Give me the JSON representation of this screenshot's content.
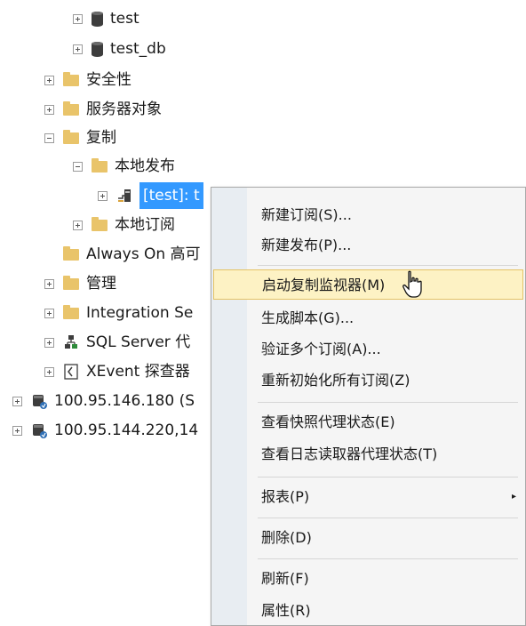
{
  "tree": {
    "nodes": [
      {
        "label": "test",
        "icon": "database-icon"
      },
      {
        "label": "test_db",
        "icon": "database-icon"
      },
      {
        "label": "安全性",
        "icon": "folder-icon"
      },
      {
        "label": "服务器对象",
        "icon": "folder-icon"
      },
      {
        "label": "复制",
        "icon": "folder-icon"
      },
      {
        "label": "本地发布",
        "icon": "folder-icon"
      },
      {
        "label": "[test]: t",
        "icon": "publication-icon"
      },
      {
        "label": "本地订阅",
        "icon": "folder-icon"
      },
      {
        "label": "Always On 高可",
        "icon": "folder-icon"
      },
      {
        "label": "管理",
        "icon": "folder-icon"
      },
      {
        "label": "Integration Se",
        "icon": "folder-icon"
      },
      {
        "label": "SQL Server 代",
        "icon": "agent-icon"
      },
      {
        "label": "XEvent 探查器",
        "icon": "xevent-icon"
      },
      {
        "label": "100.95.146.180 (S",
        "icon": "server-icon"
      },
      {
        "label": "100.95.144.220,14",
        "icon": "server-icon"
      }
    ]
  },
  "context_menu": {
    "items": [
      {
        "label": "新建订阅(S)..."
      },
      {
        "label": "新建发布(P)..."
      },
      {
        "label": "启动复制监视器(M)"
      },
      {
        "label": "生成脚本(G)..."
      },
      {
        "label": "验证多个订阅(A)..."
      },
      {
        "label": "重新初始化所有订阅(Z)"
      },
      {
        "label": "查看快照代理状态(E)"
      },
      {
        "label": "查看日志读取器代理状态(T)"
      },
      {
        "label": "报表(P)"
      },
      {
        "label": "删除(D)"
      },
      {
        "label": "刷新(F)"
      },
      {
        "label": "属性(R)"
      }
    ],
    "highlighted_index": 2,
    "submenu_arrow": "▸"
  },
  "colors": {
    "selection": "#3399ff",
    "menu_highlight": "#fdf2c4",
    "folder": "#e9c46a"
  }
}
